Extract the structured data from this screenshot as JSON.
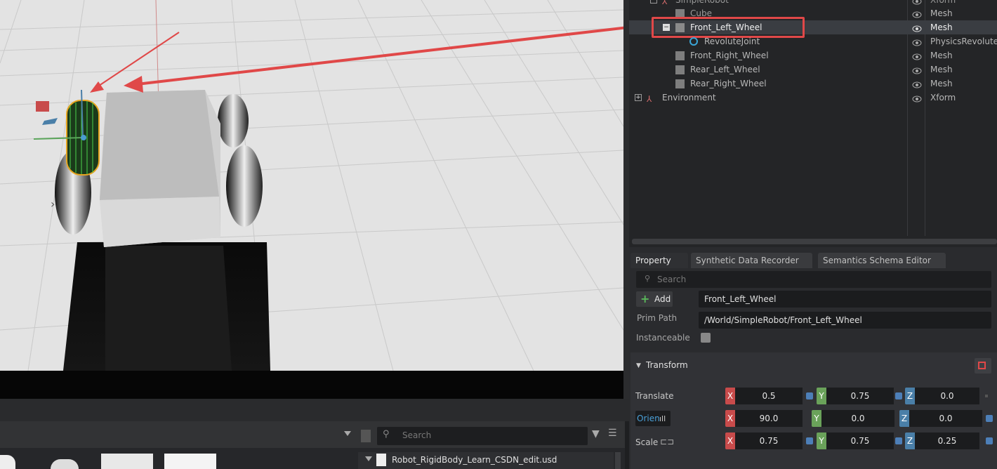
{
  "stage": {
    "rows": [
      {
        "name": "SimpleRobot",
        "type": "Xform"
      },
      {
        "name": "Cube",
        "type": "Mesh"
      },
      {
        "name": "Front_Left_Wheel",
        "type": "Mesh"
      },
      {
        "name": "RevoluteJoint",
        "type": "PhysicsRevolute"
      },
      {
        "name": "Front_Right_Wheel",
        "type": "Mesh"
      },
      {
        "name": "Rear_Left_Wheel",
        "type": "Mesh"
      },
      {
        "name": "Rear_Right_Wheel",
        "type": "Mesh"
      },
      {
        "name": "Environment",
        "type": "Xform"
      }
    ]
  },
  "property": {
    "tabs": [
      "Property",
      "Synthetic Data Recorder",
      "Semantics Schema Editor"
    ],
    "search_placeholder": "Search",
    "add_label": "Add",
    "prim_name": "Front_Left_Wheel",
    "prim_path_label": "Prim Path",
    "prim_path": "/World/SimpleRobot/Front_Left_Wheel",
    "instanceable_label": "Instanceable",
    "transform_label": "Transform",
    "translate_label": "Translate",
    "orient_label": "Orien",
    "scale_label": "Scale",
    "translate": {
      "x": "0.5",
      "y": "0.75",
      "z": "0.0"
    },
    "orient": {
      "x": "90.0",
      "y": "0.0",
      "z": "0.0"
    },
    "scale": {
      "x": "0.75",
      "y": "0.75",
      "z": "0.25"
    },
    "axis_x": "X",
    "axis_y": "Y",
    "axis_z": "Z"
  },
  "content": {
    "search_placeholder": "Search",
    "file_name": "Robot_RigidBody_Learn_CSDN_edit.usd"
  },
  "colors": {
    "highlight": "#e04848",
    "selection": "#3a3d42"
  }
}
